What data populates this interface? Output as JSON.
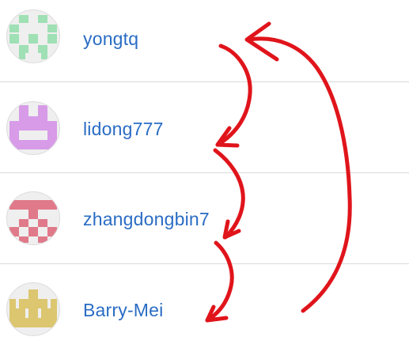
{
  "users": [
    {
      "username": "yongtq",
      "avatar_color": "#9fe0b4",
      "avatar_icon": "identicon-green"
    },
    {
      "username": "lidong777",
      "avatar_color": "#d79be8",
      "avatar_icon": "identicon-purple"
    },
    {
      "username": "zhangdongbin7",
      "avatar_color": "#e07a8a",
      "avatar_icon": "identicon-red"
    },
    {
      "username": "Barry-Mei",
      "avatar_color": "#dcc66f",
      "avatar_icon": "identicon-yellow"
    }
  ],
  "annotation": {
    "color": "#e0141b",
    "icon": "hand-drawn-red-arrows"
  }
}
